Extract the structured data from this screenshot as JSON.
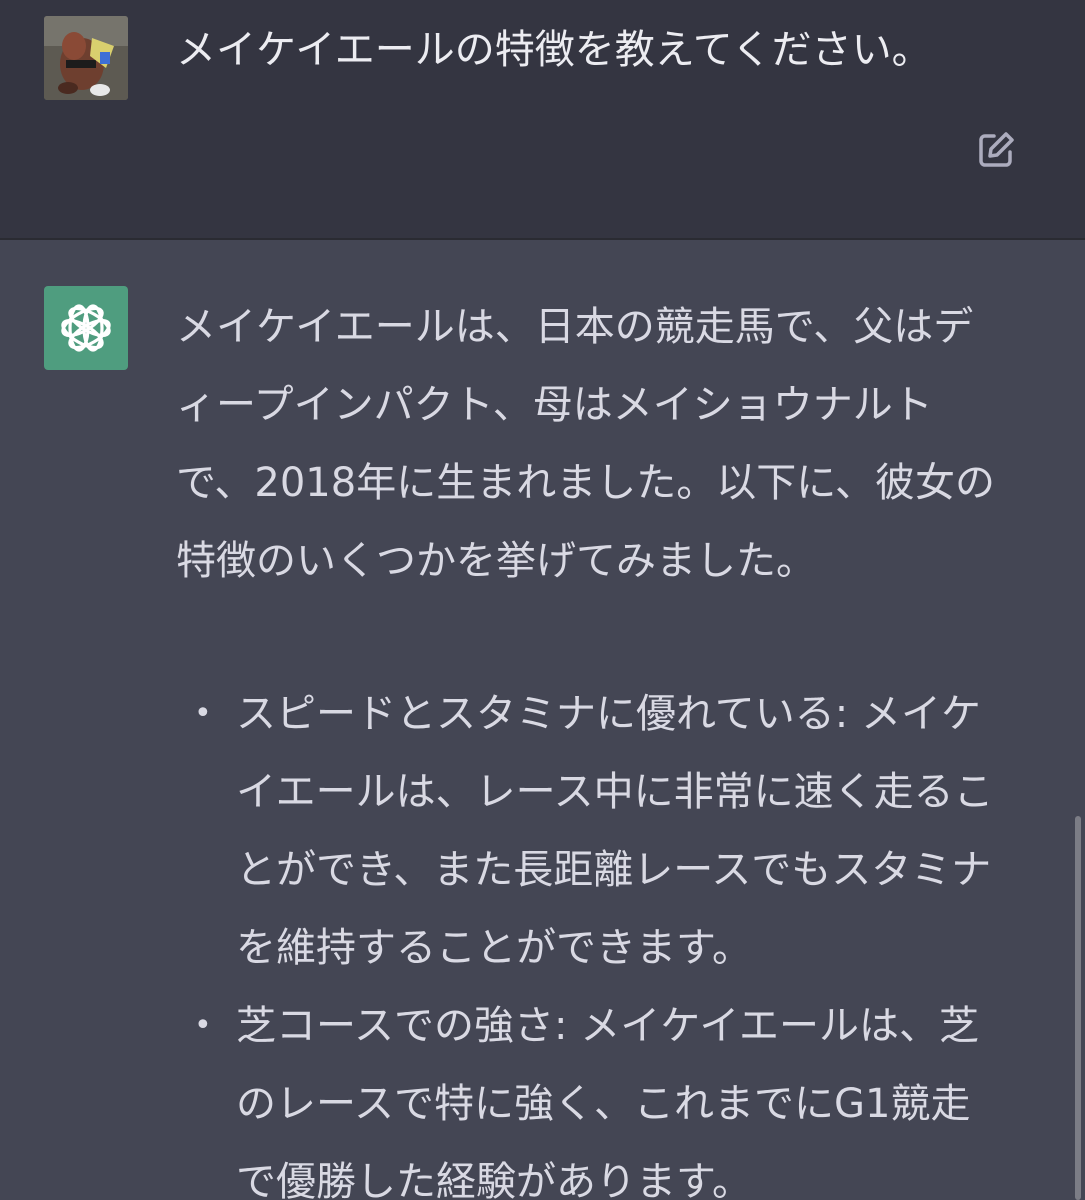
{
  "user_message": {
    "avatar": "user-avatar-photo",
    "text": "メイケイエールの特徴を教えてください。",
    "edit_icon": "edit-icon"
  },
  "assistant_message": {
    "avatar": "chatgpt-logo-icon",
    "intro_lines": [
      "メイケイエールは、日本の競走馬で、父はデ",
      "ィープインパクト、母はメイショウナルト",
      "で、2018年に生まれました。以下に、彼女の",
      "特徴のいくつかを挙げてみました。"
    ],
    "bullet_symbol": "•",
    "bullets": [
      {
        "lines": [
          "スピードとスタミナに優れている: メイケ",
          "イエールは、レース中に非常に速く走るこ",
          "とができ、また長距離レースでもスタミナ",
          "を維持することができます。"
        ]
      },
      {
        "lines": [
          "芝コースでの強さ: メイケイエールは、芝",
          "のレースで特に強く、これまでにG1競走",
          "で優勝した経験があります。"
        ]
      }
    ]
  },
  "colors": {
    "user_bg": "#343541",
    "assistant_bg": "#444654",
    "text": "#d9d9e3",
    "gpt_green": "#4f9d7f"
  }
}
